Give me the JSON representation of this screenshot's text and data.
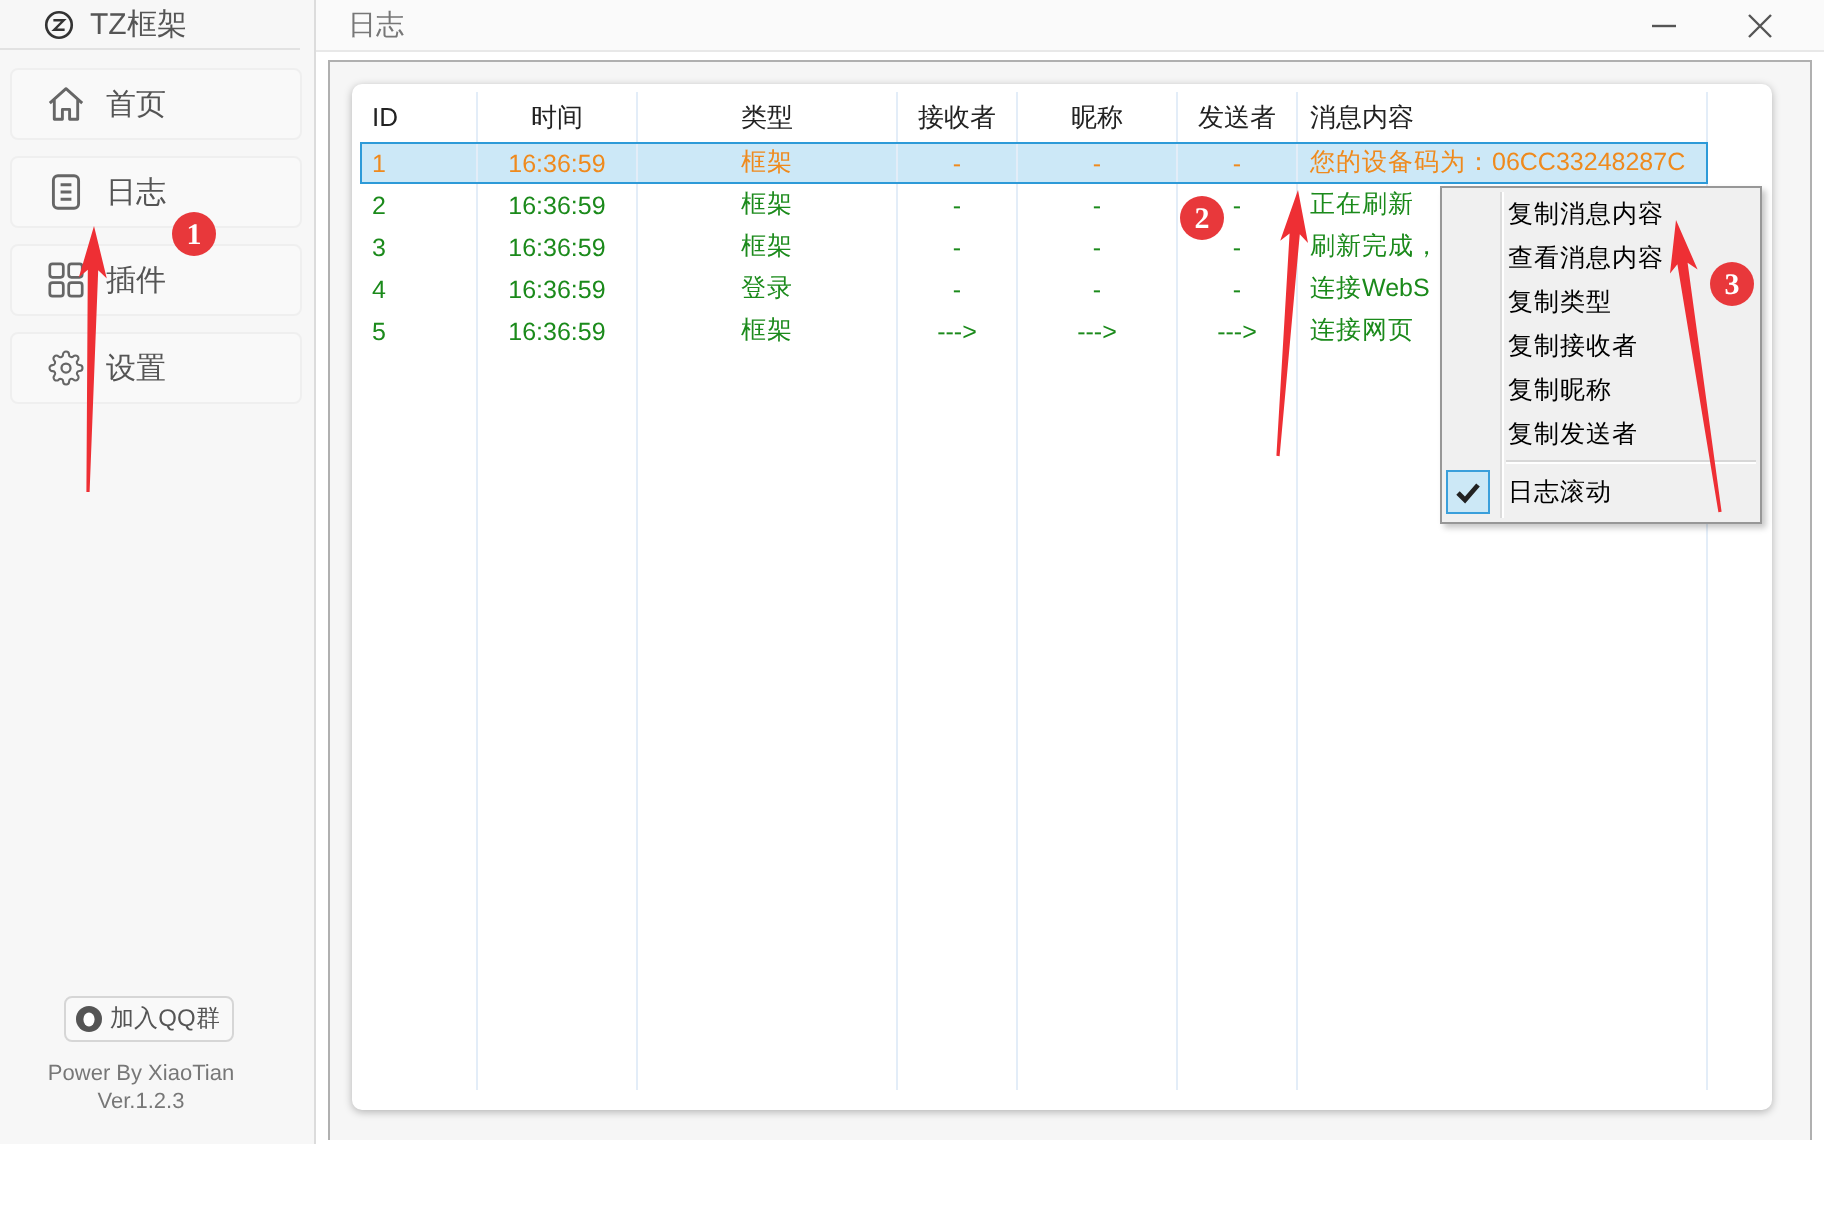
{
  "sidebar": {
    "title": "TZ框架",
    "items": [
      {
        "label": "首页",
        "kind": "home"
      },
      {
        "label": "日志",
        "kind": "log"
      },
      {
        "label": "插件",
        "kind": "plugin"
      },
      {
        "label": "设置",
        "kind": "settings"
      }
    ],
    "group_button": "加入QQ群",
    "credit": "Power By XiaoTian",
    "version": "Ver.1.2.3"
  },
  "window": {
    "title": "日志"
  },
  "table": {
    "columns": [
      "ID",
      "时间",
      "类型",
      "接收者",
      "昵称",
      "发送者",
      "消息内容"
    ],
    "rows": [
      {
        "id": "1",
        "time": "16:36:59",
        "type": "框架",
        "receiver": "-",
        "nickname": "-",
        "sender": "-",
        "message": "您的设备码为：06CC33248287C",
        "selected": true,
        "color": "#ef8a1d"
      },
      {
        "id": "2",
        "time": "16:36:59",
        "type": "框架",
        "receiver": "-",
        "nickname": "-",
        "sender": "-",
        "message": "正在刷新",
        "selected": false,
        "color": "#1b8a1b"
      },
      {
        "id": "3",
        "time": "16:36:59",
        "type": "框架",
        "receiver": "-",
        "nickname": "-",
        "sender": "-",
        "message": "刷新完成，",
        "selected": false,
        "color": "#1b8a1b"
      },
      {
        "id": "4",
        "time": "16:36:59",
        "type": "登录",
        "receiver": "-",
        "nickname": "-",
        "sender": "-",
        "message": "连接WebS",
        "selected": false,
        "color": "#1b8a1b"
      },
      {
        "id": "5",
        "time": "16:36:59",
        "type": "框架",
        "receiver": "--->",
        "nickname": "--->",
        "sender": "--->",
        "message": "连接网页",
        "selected": false,
        "color": "#1b8a1b"
      }
    ]
  },
  "context_menu": {
    "items": [
      {
        "label": "复制消息内容",
        "kind": "action"
      },
      {
        "label": "查看消息内容",
        "kind": "action"
      },
      {
        "label": "复制类型",
        "kind": "action"
      },
      {
        "label": "复制接收者",
        "kind": "action"
      },
      {
        "label": "复制昵称",
        "kind": "action"
      },
      {
        "label": "复制发送者",
        "kind": "action"
      },
      {
        "label": "日志滚动",
        "kind": "check",
        "checked": true
      }
    ]
  },
  "annotations": [
    {
      "number": "1"
    },
    {
      "number": "2"
    },
    {
      "number": "3"
    }
  ]
}
